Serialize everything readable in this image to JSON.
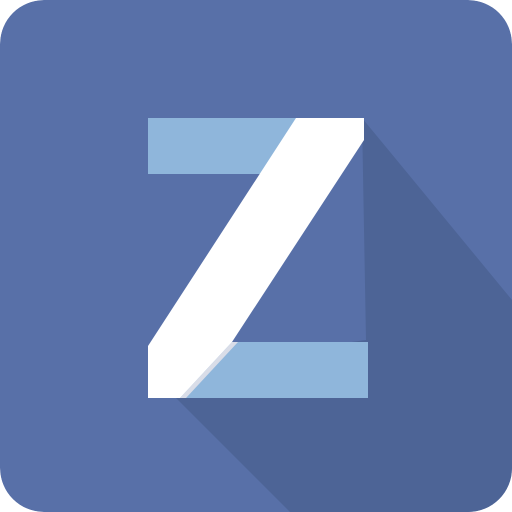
{
  "icon": {
    "glyph": "Z",
    "semantic": "z-logo-icon",
    "colors": {
      "background": "#5870a8",
      "long_shadow": "#4d6496",
      "bar_light_blue": "#8fb6db",
      "diagonal_white": "#ffffff",
      "fold_shade": "#d9dde8"
    }
  }
}
